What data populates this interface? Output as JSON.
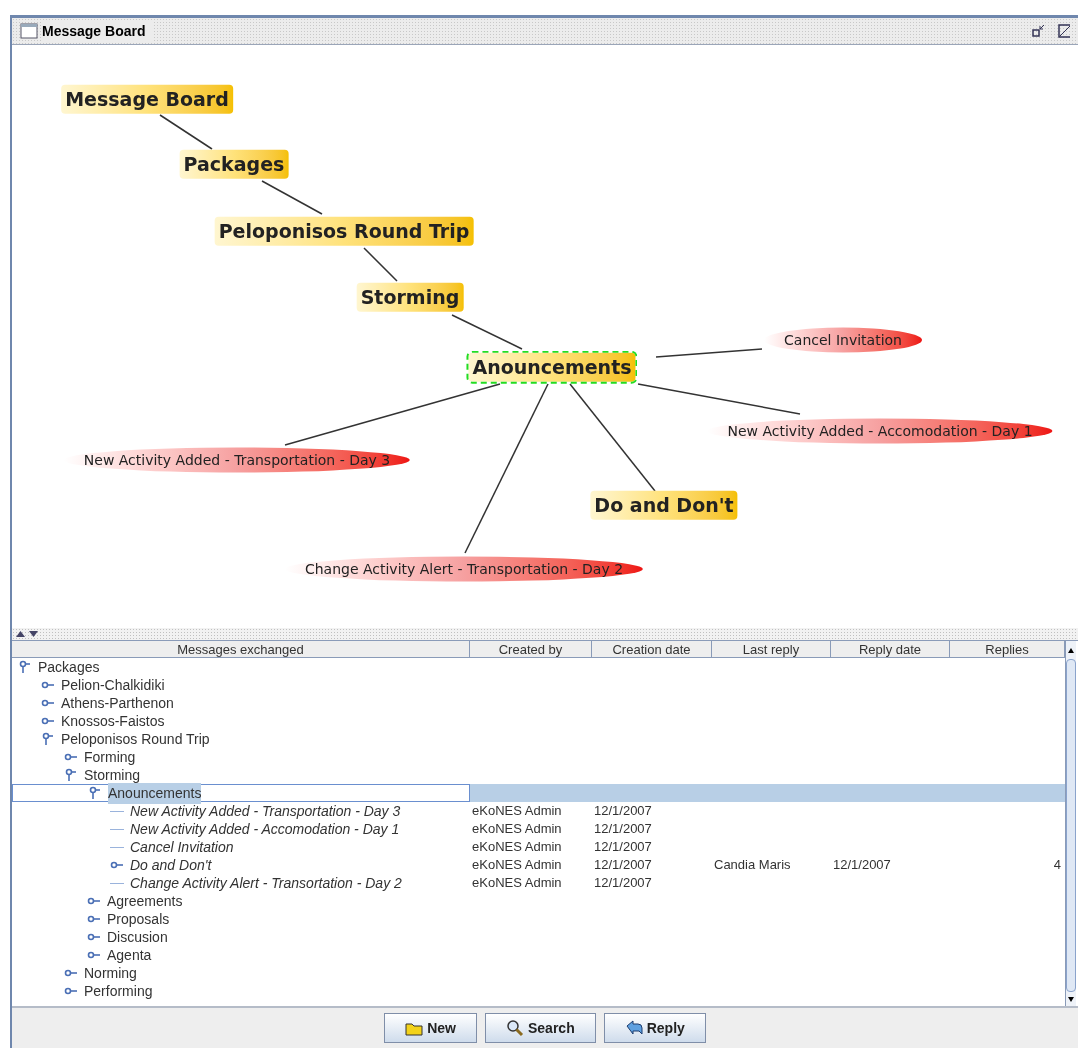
{
  "window": {
    "title": "Message Board"
  },
  "graph": {
    "nodes": [
      {
        "label": "Message Board",
        "kind": "category",
        "selected": false
      },
      {
        "label": "Packages",
        "kind": "category",
        "selected": false
      },
      {
        "label": "Peloponisos Round Trip",
        "kind": "category",
        "selected": false
      },
      {
        "label": "Storming",
        "kind": "category",
        "selected": false
      },
      {
        "label": "Anouncements",
        "kind": "category",
        "selected": true
      },
      {
        "label": "Cancel Invitation",
        "kind": "message",
        "selected": false
      },
      {
        "label": "New Activity Added - Accomodation - Day 1",
        "kind": "message",
        "selected": false
      },
      {
        "label": "New Activity Added - Transportation - Day 3",
        "kind": "message",
        "selected": false
      },
      {
        "label": "Do and Don't",
        "kind": "category",
        "selected": false
      },
      {
        "label": "Change Activity Alert - Transportation - Day 2",
        "kind": "message",
        "selected": false
      }
    ]
  },
  "table": {
    "columns": [
      "Messages exchanged",
      "Created by",
      "Creation date",
      "Last reply",
      "Reply date",
      "Replies"
    ],
    "tree": [
      {
        "label": "Packages",
        "kind": "folder",
        "expanded": true,
        "selected": false,
        "children": [
          {
            "label": "Pelion-Chalkidiki",
            "kind": "folder",
            "expanded": false,
            "selected": false
          },
          {
            "label": "Athens-Parthenon",
            "kind": "folder",
            "expanded": false,
            "selected": false
          },
          {
            "label": "Knossos-Faistos",
            "kind": "folder",
            "expanded": false,
            "selected": false
          },
          {
            "label": "Peloponisos Round Trip",
            "kind": "folder",
            "expanded": true,
            "selected": false,
            "children": [
              {
                "label": "Forming",
                "kind": "folder",
                "expanded": false,
                "selected": false
              },
              {
                "label": "Storming",
                "kind": "folder",
                "expanded": true,
                "selected": false,
                "children": [
                  {
                    "label": "Anouncements",
                    "kind": "folder",
                    "expanded": true,
                    "selected": true,
                    "children": [
                      {
                        "label": "New Activity Added - Transportation - Day 3",
                        "kind": "message",
                        "selected": false,
                        "cells": [
                          "eKoNES Admin",
                          "12/1/2007"
                        ]
                      },
                      {
                        "label": "New Activity Added - Accomodation - Day 1",
                        "kind": "message",
                        "selected": false,
                        "cells": [
                          "eKoNES Admin",
                          "12/1/2007"
                        ]
                      },
                      {
                        "label": "Cancel Invitation",
                        "kind": "message",
                        "selected": false,
                        "cells": [
                          "eKoNES Admin",
                          "12/1/2007"
                        ]
                      },
                      {
                        "label": "Do and Don't",
                        "kind": "thread",
                        "expanded": false,
                        "selected": false,
                        "cells": [
                          "eKoNES Admin",
                          "12/1/2007",
                          "Candia Maris",
                          "12/1/2007",
                          "4"
                        ]
                      },
                      {
                        "label": "Change Activity Alert - Transortation - Day 2",
                        "kind": "message",
                        "selected": false,
                        "cells": [
                          "eKoNES Admin",
                          "12/1/2007"
                        ]
                      }
                    ]
                  },
                  {
                    "label": "Agreements",
                    "kind": "folder",
                    "expanded": false,
                    "selected": false
                  },
                  {
                    "label": "Proposals",
                    "kind": "folder",
                    "expanded": false,
                    "selected": false
                  },
                  {
                    "label": "Discusion",
                    "kind": "folder",
                    "expanded": false,
                    "selected": false
                  },
                  {
                    "label": "Agenta",
                    "kind": "folder",
                    "expanded": false,
                    "selected": false
                  }
                ]
              },
              {
                "label": "Norming",
                "kind": "folder",
                "expanded": false,
                "selected": false
              },
              {
                "label": "Performing",
                "kind": "folder",
                "expanded": false,
                "selected": false
              }
            ]
          }
        ]
      }
    ]
  },
  "buttons": [
    {
      "label": "New",
      "kind": "new"
    },
    {
      "label": "Search",
      "kind": "search"
    },
    {
      "label": "Reply",
      "kind": "reply"
    }
  ]
}
